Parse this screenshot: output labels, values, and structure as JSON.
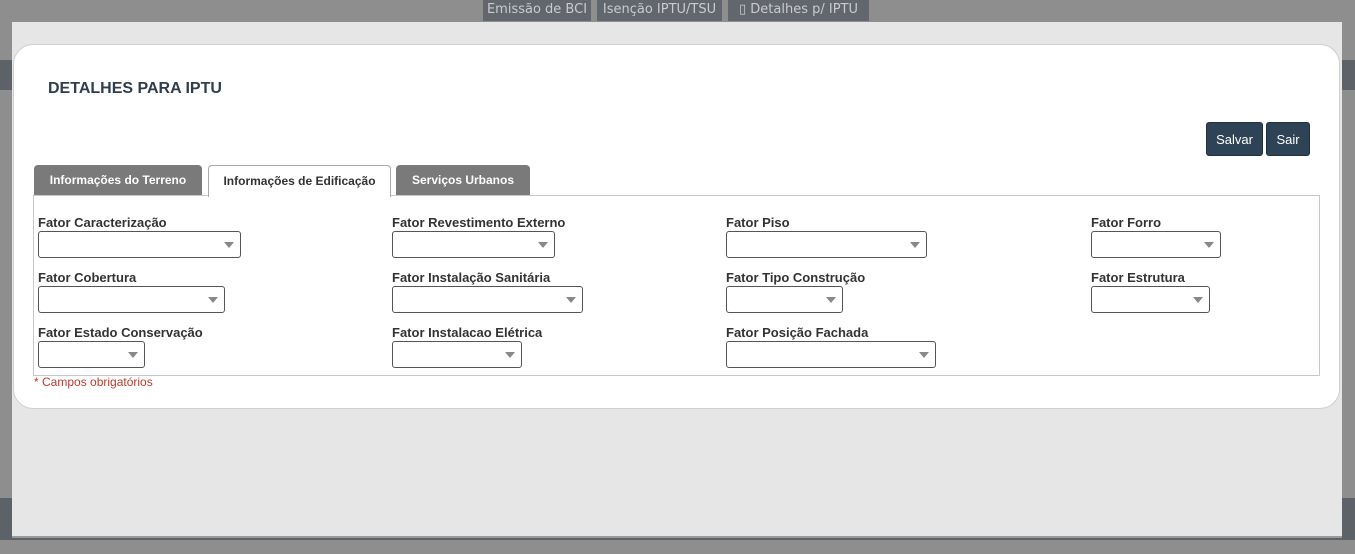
{
  "top_nav": {
    "items": [
      {
        "label": "Emissão de BCI"
      },
      {
        "label": "Isenção IPTU/TSU"
      },
      {
        "label": "Detalhes p/ IPTU",
        "icon": "clipboard-icon"
      }
    ]
  },
  "modal": {
    "title": "DETALHES PARA IPTU",
    "buttons": {
      "save": "Salvar",
      "exit": "Sair"
    },
    "tabs": [
      {
        "label": "Informações do Terreno",
        "active": false
      },
      {
        "label": "Informações de Edificação",
        "active": true
      },
      {
        "label": "Serviços Urbanos",
        "active": false
      }
    ],
    "fields": [
      {
        "label": "Fator Caracterização",
        "value": ""
      },
      {
        "label": "Fator Revestimento Externo",
        "value": ""
      },
      {
        "label": "Fator Piso",
        "value": ""
      },
      {
        "label": "Fator Forro",
        "value": ""
      },
      {
        "label": "Fator Cobertura",
        "value": ""
      },
      {
        "label": "Fator Instalação Sanitária",
        "value": ""
      },
      {
        "label": "Fator Tipo Construção",
        "value": ""
      },
      {
        "label": "Fator Estrutura",
        "value": ""
      },
      {
        "label": "Fator Estado Conservação",
        "value": ""
      },
      {
        "label": "Fator Instalacao Elétrica",
        "value": ""
      },
      {
        "label": "Fator Posição Fachada",
        "value": ""
      }
    ],
    "required_note": "* Campos obrigatórios"
  },
  "colors": {
    "primary_button": "#2e4356",
    "inactive_tab": "#7a7a7a",
    "required": "#c0392b"
  }
}
